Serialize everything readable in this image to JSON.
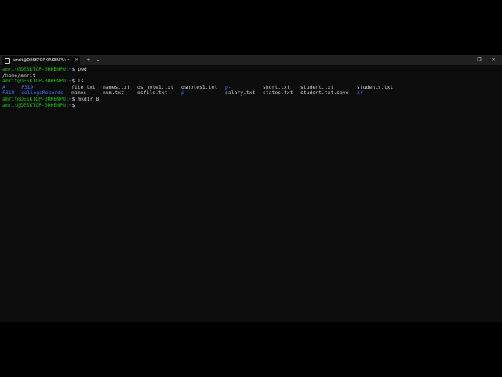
{
  "window": {
    "tab_title": "amrit@DESKTOP-0RKENPU: ~",
    "tab_close": "×",
    "new_tab": "+",
    "dropdown": "⌄",
    "minimize": "–",
    "maximize": "❐",
    "close": "✕"
  },
  "prompt": {
    "user_host": "amrit@DESKTOP-0RKENPU",
    "sep": ":",
    "path": "~",
    "dollar": "$"
  },
  "commands": {
    "c1": " pwd",
    "c2": " ls",
    "c3": " mkdir B"
  },
  "output": {
    "pwd": "/home/amrit",
    "ls_row1": [
      {
        "text": "A",
        "type": "dir"
      },
      {
        "text": "F319",
        "type": "dir"
      },
      {
        "text": "file.txt",
        "type": "file"
      },
      {
        "text": "names.txt",
        "type": "file"
      },
      {
        "text": "os_note1.txt",
        "type": "file"
      },
      {
        "text": "osnotes1.tet",
        "type": "file"
      },
      {
        "text": "p-",
        "type": "dir"
      },
      {
        "text": "short.txt",
        "type": "file"
      },
      {
        "text": "student.txt",
        "type": "file"
      },
      {
        "text": "students.txt",
        "type": "file"
      }
    ],
    "ls_row2": [
      {
        "text": "F318",
        "type": "dir"
      },
      {
        "text": "collegeRecords",
        "type": "dir"
      },
      {
        "text": "names",
        "type": "file"
      },
      {
        "text": "num.txt",
        "type": "file"
      },
      {
        "text": "osfile.txt",
        "type": "file"
      },
      {
        "text": "p",
        "type": "dir"
      },
      {
        "text": "salary.txt",
        "type": "file"
      },
      {
        "text": "states.txt",
        "type": "file"
      },
      {
        "text": "student.txt.save",
        "type": "file"
      },
      {
        "text": "xr",
        "type": "dir"
      }
    ]
  },
  "colors": {
    "prompt_user": "#16c60c",
    "prompt_path": "#3b78ff",
    "text": "#cccccc",
    "background": "#0c0c0c"
  }
}
